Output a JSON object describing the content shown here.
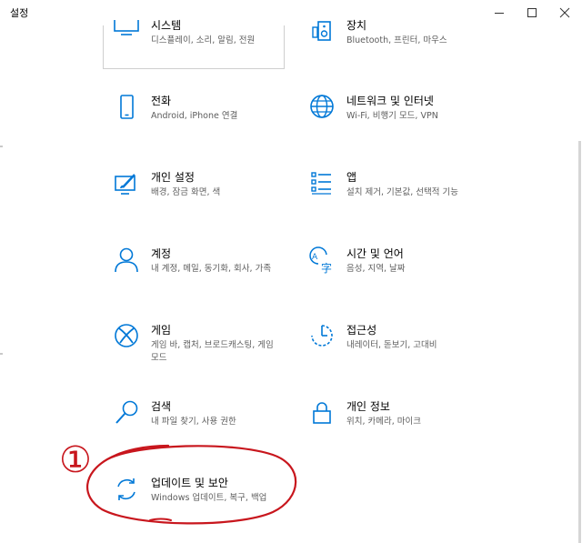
{
  "window": {
    "title": "설정",
    "controls": {
      "minimize": "minimize",
      "maximize": "maximize",
      "close": "close"
    }
  },
  "tiles": [
    {
      "label": "시스템",
      "desc": "디스플레이, 소리, 알림, 전원",
      "icon": "monitor-icon"
    },
    {
      "label": "장치",
      "desc": "Bluetooth, 프린터, 마우스",
      "icon": "devices-icon"
    },
    {
      "label": "전화",
      "desc": "Android, iPhone 연결",
      "icon": "phone-icon"
    },
    {
      "label": "네트워크 및 인터넷",
      "desc": "Wi-Fi, 비행기 모드, VPN",
      "icon": "globe-icon"
    },
    {
      "label": "개인 설정",
      "desc": "배경, 잠금 화면, 색",
      "icon": "paint-icon"
    },
    {
      "label": "앱",
      "desc": "설치 제거, 기본값, 선택적 기능",
      "icon": "apps-list-icon"
    },
    {
      "label": "계정",
      "desc": "내 계정, 메일, 동기화, 회사, 가족",
      "icon": "person-icon"
    },
    {
      "label": "시간 및 언어",
      "desc": "음성, 지역, 날짜",
      "icon": "time-language-icon"
    },
    {
      "label": "게임",
      "desc": "게임 바, 캡처, 브로드캐스팅, 게임 모드",
      "icon": "xbox-icon"
    },
    {
      "label": "접근성",
      "desc": "내레이터, 돋보기, 고대비",
      "icon": "accessibility-icon"
    },
    {
      "label": "검색",
      "desc": "내 파일 찾기, 사용 권한",
      "icon": "search-icon"
    },
    {
      "label": "개인 정보",
      "desc": "위치, 카메라, 마이크",
      "icon": "lock-icon"
    },
    {
      "label": "업데이트 및 보안",
      "desc": "Windows 업데이트, 복구, 백업",
      "icon": "update-icon"
    }
  ],
  "annotation": {
    "marker": "①",
    "color": "#c8161d"
  },
  "colors": {
    "accent": "#0078d7",
    "text": "#000000",
    "secondary_text": "#5d5d5d"
  }
}
